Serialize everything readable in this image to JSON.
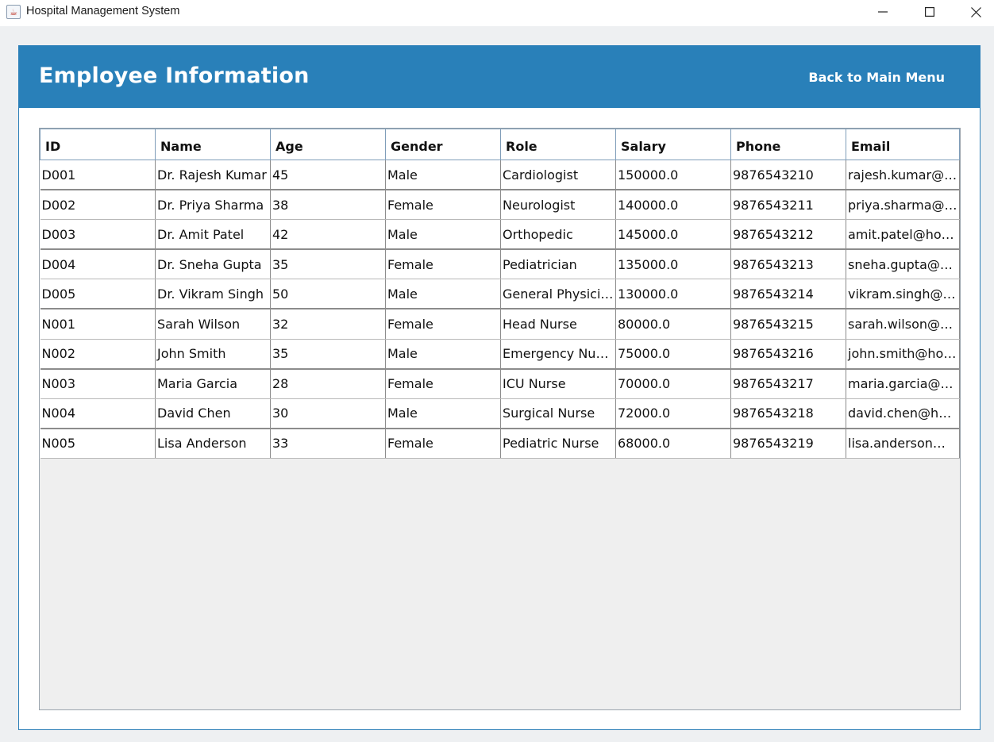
{
  "window": {
    "title": "Hospital Management System",
    "icon": "java-cup-icon",
    "controls": [
      "minimize-icon",
      "maximize-icon",
      "close-icon"
    ]
  },
  "header": {
    "title": "Employee Information",
    "back_label": "Back to Main Menu",
    "background": "#2980b9"
  },
  "table": {
    "columns": [
      "ID",
      "Name",
      "Age",
      "Gender",
      "Role",
      "Salary",
      "Phone",
      "Email"
    ],
    "rows": [
      [
        "D001",
        "Dr. Rajesh Kumar",
        "45",
        "Male",
        "Cardiologist",
        "150000.0",
        "9876543210",
        "rajesh.kumar@h…"
      ],
      [
        "D002",
        "Dr. Priya Sharma",
        "38",
        "Female",
        "Neurologist",
        "140000.0",
        "9876543211",
        "priya.sharma@h…"
      ],
      [
        "D003",
        "Dr. Amit Patel",
        "42",
        "Male",
        "Orthopedic",
        "145000.0",
        "9876543212",
        "amit.patel@hos…"
      ],
      [
        "D004",
        "Dr. Sneha Gupta",
        "35",
        "Female",
        "Pediatrician",
        "135000.0",
        "9876543213",
        "sneha.gupta@h…"
      ],
      [
        "D005",
        "Dr. Vikram Singh",
        "50",
        "Male",
        "General Physician",
        "130000.0",
        "9876543214",
        "vikram.singh@h…"
      ],
      [
        "N001",
        "Sarah Wilson",
        "32",
        "Female",
        "Head Nurse",
        "80000.0",
        "9876543215",
        "sarah.wilson@h…"
      ],
      [
        "N002",
        "John Smith",
        "35",
        "Male",
        "Emergency Nurse",
        "75000.0",
        "9876543216",
        "john.smith@ho…"
      ],
      [
        "N003",
        "Maria Garcia",
        "28",
        "Female",
        "ICU Nurse",
        "70000.0",
        "9876543217",
        "maria.garcia@h…"
      ],
      [
        "N004",
        "David Chen",
        "30",
        "Male",
        "Surgical Nurse",
        "72000.0",
        "9876543218",
        "david.chen@ho…"
      ],
      [
        "N005",
        "Lisa Anderson",
        "33",
        "Female",
        "Pediatric Nurse",
        "68000.0",
        "9876543219",
        "lisa.anderson@…"
      ]
    ]
  }
}
